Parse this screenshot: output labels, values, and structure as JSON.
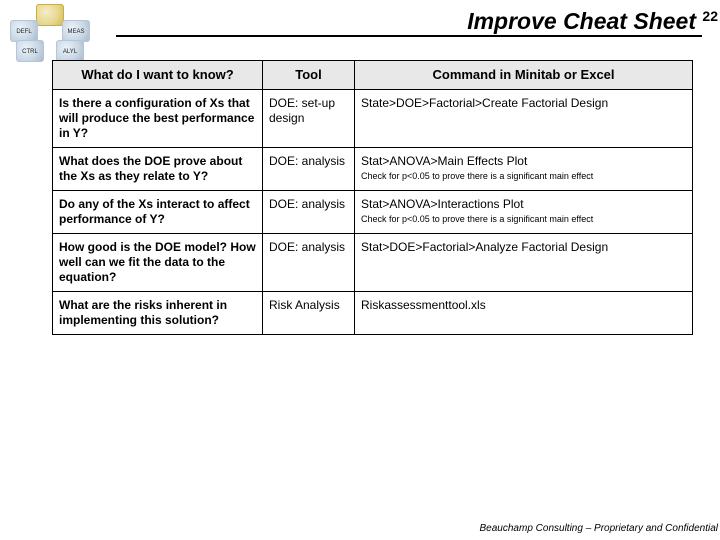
{
  "page_number": "22",
  "title": "Improve Cheat Sheet",
  "logo_labels": {
    "top": "",
    "left": "DEFL",
    "right": "MEAS",
    "bottom_left": "CTRL",
    "bottom_right": "ALYL"
  },
  "headers": {
    "col1": "What do I want to know?",
    "col2": "Tool",
    "col3": "Command in Minitab or Excel"
  },
  "rows": [
    {
      "question": "Is there a configuration of Xs that will produce the best performance in Y?",
      "tool": "DOE: set-up design",
      "command": "State>DOE>Factorial>Create Factorial Design",
      "note": ""
    },
    {
      "question": "What does the DOE prove about the Xs as they relate to Y?",
      "tool": "DOE: analysis",
      "command": "Stat>ANOVA>Main Effects Plot",
      "note": "Check for p<0.05 to prove there is a significant main effect"
    },
    {
      "question": "Do any of the Xs interact to affect performance of Y?",
      "tool": "DOE: analysis",
      "command": "Stat>ANOVA>Interactions Plot",
      "note": "Check for p<0.05 to prove there is a significant main effect"
    },
    {
      "question": "How good is the DOE model?  How well can we fit the data to the equation?",
      "tool": "DOE: analysis",
      "command": "Stat>DOE>Factorial>Analyze Factorial Design",
      "note": ""
    },
    {
      "question": "What are the risks inherent in implementing this solution?",
      "tool": "Risk Analysis",
      "command": "Riskassessmenttool.xls",
      "note": ""
    }
  ],
  "footer": "Beauchamp Consulting – Proprietary and Confidential"
}
